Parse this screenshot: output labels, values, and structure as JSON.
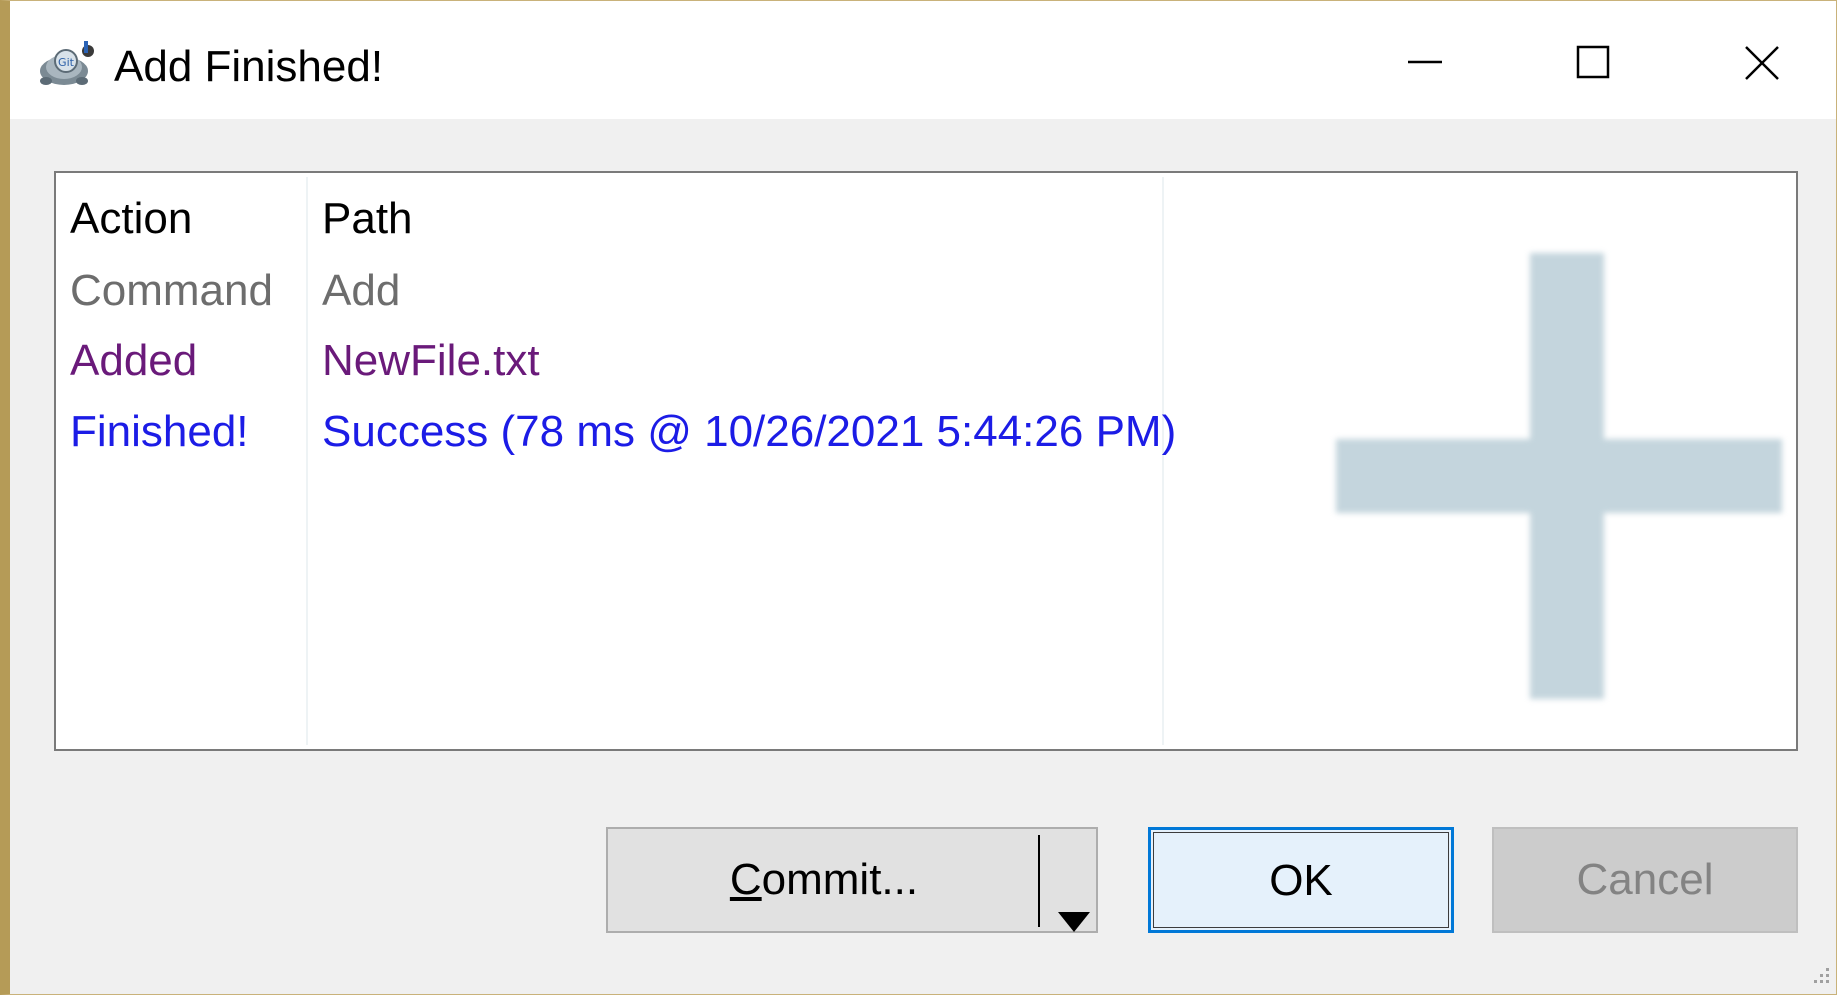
{
  "window": {
    "title": "Add Finished!",
    "icon": "tortoisegit-icon"
  },
  "titlebar_controls": {
    "minimize_icon": "minimize-icon",
    "maximize_icon": "maximize-icon",
    "close_icon": "close-icon"
  },
  "list": {
    "columns": [
      "Action",
      "Path"
    ],
    "rows": [
      {
        "action": "Command",
        "path": "Add",
        "color": "#6d6d6d"
      },
      {
        "action": "Added",
        "path": "NewFile.txt",
        "color": "#6a1a7a"
      },
      {
        "action": "Finished!",
        "path": "Success (78 ms @ 10/26/2021 5:44:26 PM)",
        "color": "#1c1ce6"
      }
    ],
    "watermark_icon": "plus-icon"
  },
  "buttons": {
    "commit_label_first": "C",
    "commit_label_rest": "ommit...",
    "commit_dropdown_icon": "chevron-down-icon",
    "ok_label": "OK",
    "cancel_label": "Cancel"
  },
  "colors": {
    "accent": "#0078d7",
    "watermark": "#c4d5dd"
  }
}
